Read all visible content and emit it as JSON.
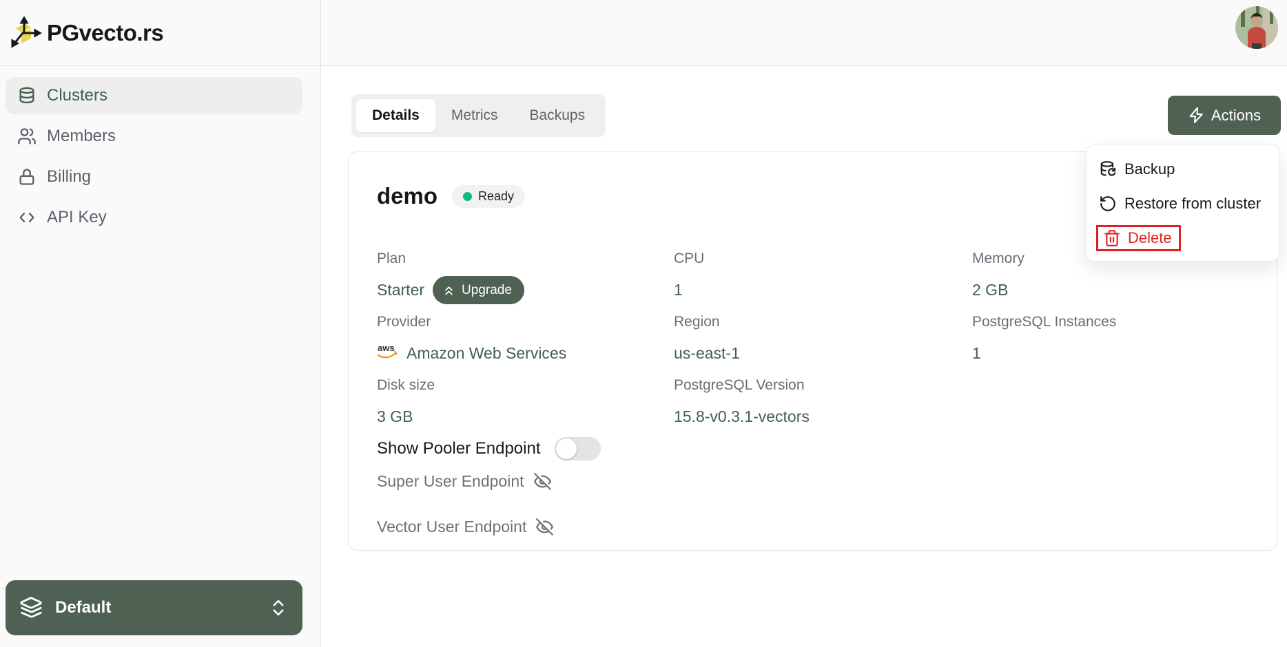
{
  "brand": {
    "name": "PGvecto.rs"
  },
  "sidebar": {
    "items": [
      {
        "label": "Clusters",
        "icon": "database-icon",
        "active": true
      },
      {
        "label": "Members",
        "icon": "users-icon",
        "active": false
      },
      {
        "label": "Billing",
        "icon": "lock-icon",
        "active": false
      },
      {
        "label": "API Key",
        "icon": "code-icon",
        "active": false
      }
    ],
    "workspace": {
      "label": "Default",
      "icon": "layers-icon"
    }
  },
  "topbar": {
    "avatar": "user-avatar"
  },
  "tabs": [
    {
      "label": "Details",
      "active": true
    },
    {
      "label": "Metrics",
      "active": false
    },
    {
      "label": "Backups",
      "active": false
    }
  ],
  "actions": {
    "button_label": "Actions",
    "menu": [
      {
        "label": "Backup",
        "icon": "database-backup-icon",
        "danger": false,
        "highlighted": false
      },
      {
        "label": "Restore from cluster",
        "icon": "restore-icon",
        "danger": false,
        "highlighted": false
      },
      {
        "label": "Delete",
        "icon": "trash-icon",
        "danger": true,
        "highlighted": true
      }
    ]
  },
  "cluster": {
    "name": "demo",
    "status": "Ready",
    "fields": [
      {
        "label": "Plan",
        "value": "Starter",
        "extra_button": "Upgrade"
      },
      {
        "label": "CPU",
        "value": "1"
      },
      {
        "label": "Memory",
        "value": "2 GB"
      },
      {
        "label": "Provider",
        "value": "Amazon Web Services",
        "icon": "aws-icon"
      },
      {
        "label": "Region",
        "value": "us-east-1"
      },
      {
        "label": "PostgreSQL Instances",
        "value": "1"
      },
      {
        "label": "Disk size",
        "value": "3 GB"
      },
      {
        "label": "PostgreSQL Version",
        "value": "15.8-v0.3.1-vectors"
      }
    ],
    "pooler_toggle": {
      "label": "Show Pooler Endpoint",
      "on": false
    },
    "endpoints": [
      {
        "label": "Super User Endpoint",
        "icon": "eye-off-icon"
      },
      {
        "label": "Vector User Endpoint",
        "icon": "eye-off-icon"
      }
    ]
  },
  "colors": {
    "accent_green": "#4e6152",
    "value_green": "#3f6249",
    "status_green": "#10b981",
    "danger_red": "#e02121",
    "logo_yellow": "#e3d84e"
  }
}
